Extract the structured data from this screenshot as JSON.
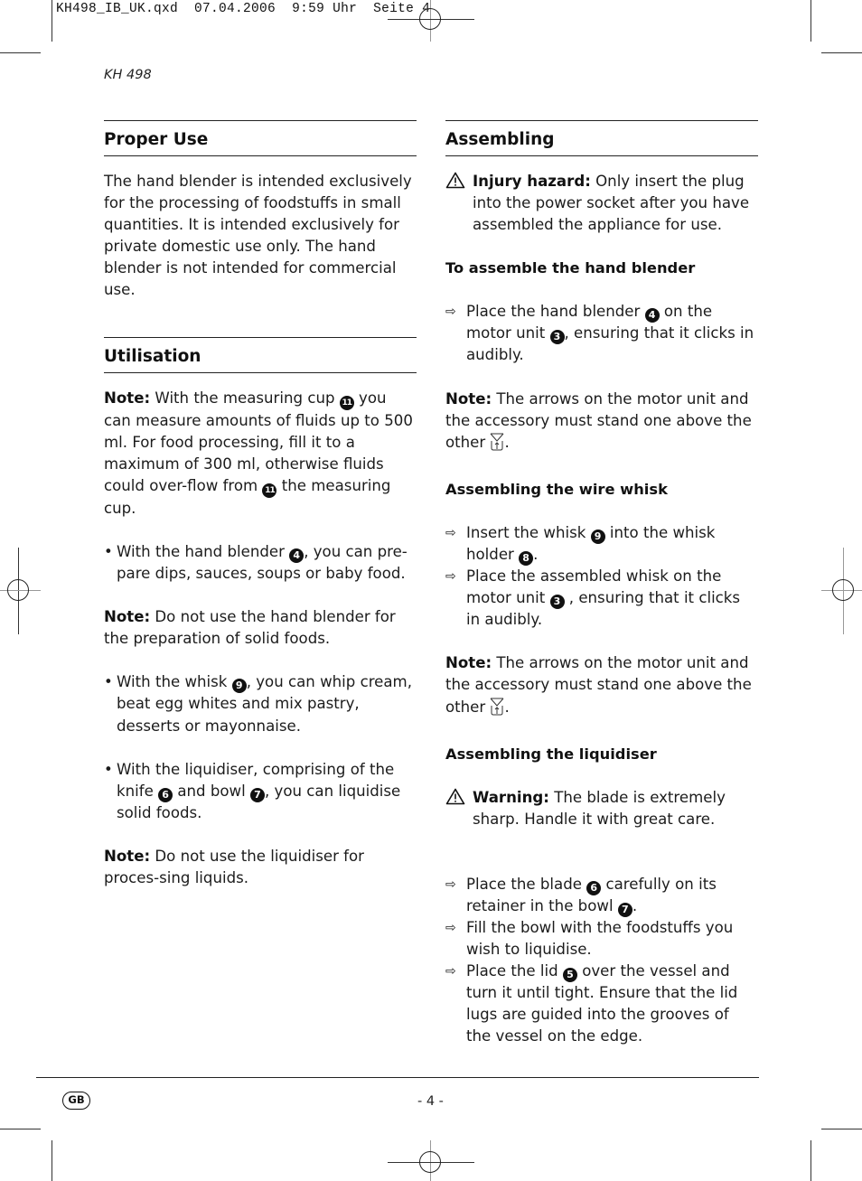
{
  "slug": {
    "filename": "KH498_IB_UK.qxd",
    "date": "07.04.2006",
    "time": "9:59 Uhr",
    "page_label": "Seite 4"
  },
  "model": "KH 498",
  "left": {
    "proper_use": {
      "heading": "Proper Use",
      "body": "The hand blender is intended exclusively for the processing of foodstuffs in small quantities. It is intended exclusively for private domestic use only. The hand blender is not intended for commercial use."
    },
    "utilisation": {
      "heading": "Utilisation",
      "note1": {
        "label": "Note:",
        "t1": " With the measuring cup ",
        "n1": "11",
        "t2": " you can measure amounts of fluids up to 500 ml. For food processing, fill it to a maximum of 300 ml, otherwise fluids could over-flow from ",
        "n2": "11",
        "t3": " the measuring cup."
      },
      "bullet1": {
        "bullet": "•",
        "t1": "With the hand blender ",
        "n1": "4",
        "t2": ", you can pre-pare dips, sauces, soups or baby food."
      },
      "note2": {
        "label": "Note:",
        "text": " Do not use the hand blender for the preparation of solid foods."
      },
      "bullet2": {
        "bullet": "•",
        "t1": "With the whisk ",
        "n1": "9",
        "t2": ", you can whip cream, beat egg whites and mix pastry, desserts or mayonnaise."
      },
      "bullet3": {
        "bullet": "•",
        "t1": "With the liquidiser, comprising of the knife ",
        "n1": "6",
        "t2": " and bowl ",
        "n2": "7",
        "t3": ", you can liquidise solid foods."
      },
      "note3": {
        "label": "Note:",
        "text": " Do not use the liquidiser for proces-sing liquids."
      }
    }
  },
  "right": {
    "assembling": {
      "heading": "Assembling",
      "hazard": {
        "icon": "⚠",
        "label": "Injury hazard:",
        "text": " Only insert the plug into the power socket after you have assembled the appliance for use."
      },
      "blender": {
        "heading": "To assemble the hand blender",
        "step1": {
          "arrow": "⇨",
          "t1": "Place the hand blender ",
          "n1": "4",
          "t2": " on the motor unit ",
          "n2": "3",
          "t3": ", ensuring that it clicks in audibly."
        },
        "note": {
          "label": "Note:",
          "text": " The arrows on the motor unit and the accessory must stand one above the other ",
          "end": "."
        }
      },
      "whisk": {
        "heading": "Assembling the wire whisk",
        "step1": {
          "arrow": "⇨",
          "t1": "Insert the whisk ",
          "n1": "9",
          "t2": " into the whisk holder ",
          "n2": "8",
          "t3": "."
        },
        "step2": {
          "arrow": "⇨",
          "t1": " Place the assembled whisk on the motor unit ",
          "n1": "3",
          "t2": " , ensuring that it clicks in audibly."
        },
        "note": {
          "label": "Note:",
          "text": " The arrows on the motor unit and the accessory must stand one above the other ",
          "end": "."
        }
      },
      "liquidiser": {
        "heading": "Assembling the liquidiser",
        "warning": {
          "icon": "⚠",
          "label": "Warning:",
          "text": " The blade is extremely sharp. Handle it with great care."
        },
        "step1": {
          "arrow": "⇨",
          "t1": "Place the blade ",
          "n1": "6",
          "t2": " carefully on its retainer in the bowl ",
          "n2": "7",
          "t3": "."
        },
        "step2": {
          "arrow": "⇨",
          "text": "Fill the bowl with the foodstuffs you wish to liquidise."
        },
        "step3": {
          "arrow": "⇨",
          "t1": "Place the lid ",
          "n1": "5",
          "t2": " over the vessel and turn it until tight. Ensure that the lid lugs are guided into the grooves of the vessel on the edge."
        }
      }
    }
  },
  "footer": {
    "country_badge": "GB",
    "page_number": "- 4 -"
  }
}
